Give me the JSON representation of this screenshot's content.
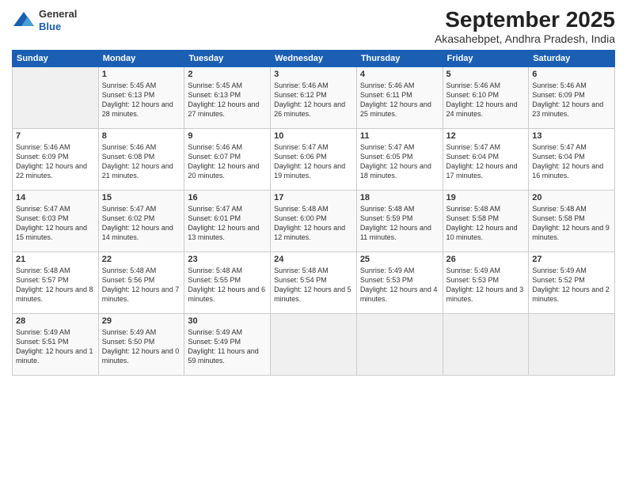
{
  "logo": {
    "general": "General",
    "blue": "Blue"
  },
  "title": "September 2025",
  "subtitle": "Akasahebpet, Andhra Pradesh, India",
  "headers": [
    "Sunday",
    "Monday",
    "Tuesday",
    "Wednesday",
    "Thursday",
    "Friday",
    "Saturday"
  ],
  "weeks": [
    [
      {
        "day": "",
        "sunrise": "",
        "sunset": "",
        "daylight": ""
      },
      {
        "day": "1",
        "sunrise": "Sunrise: 5:45 AM",
        "sunset": "Sunset: 6:13 PM",
        "daylight": "Daylight: 12 hours and 28 minutes."
      },
      {
        "day": "2",
        "sunrise": "Sunrise: 5:45 AM",
        "sunset": "Sunset: 6:13 PM",
        "daylight": "Daylight: 12 hours and 27 minutes."
      },
      {
        "day": "3",
        "sunrise": "Sunrise: 5:46 AM",
        "sunset": "Sunset: 6:12 PM",
        "daylight": "Daylight: 12 hours and 26 minutes."
      },
      {
        "day": "4",
        "sunrise": "Sunrise: 5:46 AM",
        "sunset": "Sunset: 6:11 PM",
        "daylight": "Daylight: 12 hours and 25 minutes."
      },
      {
        "day": "5",
        "sunrise": "Sunrise: 5:46 AM",
        "sunset": "Sunset: 6:10 PM",
        "daylight": "Daylight: 12 hours and 24 minutes."
      },
      {
        "day": "6",
        "sunrise": "Sunrise: 5:46 AM",
        "sunset": "Sunset: 6:09 PM",
        "daylight": "Daylight: 12 hours and 23 minutes."
      }
    ],
    [
      {
        "day": "7",
        "sunrise": "Sunrise: 5:46 AM",
        "sunset": "Sunset: 6:09 PM",
        "daylight": "Daylight: 12 hours and 22 minutes."
      },
      {
        "day": "8",
        "sunrise": "Sunrise: 5:46 AM",
        "sunset": "Sunset: 6:08 PM",
        "daylight": "Daylight: 12 hours and 21 minutes."
      },
      {
        "day": "9",
        "sunrise": "Sunrise: 5:46 AM",
        "sunset": "Sunset: 6:07 PM",
        "daylight": "Daylight: 12 hours and 20 minutes."
      },
      {
        "day": "10",
        "sunrise": "Sunrise: 5:47 AM",
        "sunset": "Sunset: 6:06 PM",
        "daylight": "Daylight: 12 hours and 19 minutes."
      },
      {
        "day": "11",
        "sunrise": "Sunrise: 5:47 AM",
        "sunset": "Sunset: 6:05 PM",
        "daylight": "Daylight: 12 hours and 18 minutes."
      },
      {
        "day": "12",
        "sunrise": "Sunrise: 5:47 AM",
        "sunset": "Sunset: 6:04 PM",
        "daylight": "Daylight: 12 hours and 17 minutes."
      },
      {
        "day": "13",
        "sunrise": "Sunrise: 5:47 AM",
        "sunset": "Sunset: 6:04 PM",
        "daylight": "Daylight: 12 hours and 16 minutes."
      }
    ],
    [
      {
        "day": "14",
        "sunrise": "Sunrise: 5:47 AM",
        "sunset": "Sunset: 6:03 PM",
        "daylight": "Daylight: 12 hours and 15 minutes."
      },
      {
        "day": "15",
        "sunrise": "Sunrise: 5:47 AM",
        "sunset": "Sunset: 6:02 PM",
        "daylight": "Daylight: 12 hours and 14 minutes."
      },
      {
        "day": "16",
        "sunrise": "Sunrise: 5:47 AM",
        "sunset": "Sunset: 6:01 PM",
        "daylight": "Daylight: 12 hours and 13 minutes."
      },
      {
        "day": "17",
        "sunrise": "Sunrise: 5:48 AM",
        "sunset": "Sunset: 6:00 PM",
        "daylight": "Daylight: 12 hours and 12 minutes."
      },
      {
        "day": "18",
        "sunrise": "Sunrise: 5:48 AM",
        "sunset": "Sunset: 5:59 PM",
        "daylight": "Daylight: 12 hours and 11 minutes."
      },
      {
        "day": "19",
        "sunrise": "Sunrise: 5:48 AM",
        "sunset": "Sunset: 5:58 PM",
        "daylight": "Daylight: 12 hours and 10 minutes."
      },
      {
        "day": "20",
        "sunrise": "Sunrise: 5:48 AM",
        "sunset": "Sunset: 5:58 PM",
        "daylight": "Daylight: 12 hours and 9 minutes."
      }
    ],
    [
      {
        "day": "21",
        "sunrise": "Sunrise: 5:48 AM",
        "sunset": "Sunset: 5:57 PM",
        "daylight": "Daylight: 12 hours and 8 minutes."
      },
      {
        "day": "22",
        "sunrise": "Sunrise: 5:48 AM",
        "sunset": "Sunset: 5:56 PM",
        "daylight": "Daylight: 12 hours and 7 minutes."
      },
      {
        "day": "23",
        "sunrise": "Sunrise: 5:48 AM",
        "sunset": "Sunset: 5:55 PM",
        "daylight": "Daylight: 12 hours and 6 minutes."
      },
      {
        "day": "24",
        "sunrise": "Sunrise: 5:48 AM",
        "sunset": "Sunset: 5:54 PM",
        "daylight": "Daylight: 12 hours and 5 minutes."
      },
      {
        "day": "25",
        "sunrise": "Sunrise: 5:49 AM",
        "sunset": "Sunset: 5:53 PM",
        "daylight": "Daylight: 12 hours and 4 minutes."
      },
      {
        "day": "26",
        "sunrise": "Sunrise: 5:49 AM",
        "sunset": "Sunset: 5:53 PM",
        "daylight": "Daylight: 12 hours and 3 minutes."
      },
      {
        "day": "27",
        "sunrise": "Sunrise: 5:49 AM",
        "sunset": "Sunset: 5:52 PM",
        "daylight": "Daylight: 12 hours and 2 minutes."
      }
    ],
    [
      {
        "day": "28",
        "sunrise": "Sunrise: 5:49 AM",
        "sunset": "Sunset: 5:51 PM",
        "daylight": "Daylight: 12 hours and 1 minute."
      },
      {
        "day": "29",
        "sunrise": "Sunrise: 5:49 AM",
        "sunset": "Sunset: 5:50 PM",
        "daylight": "Daylight: 12 hours and 0 minutes."
      },
      {
        "day": "30",
        "sunrise": "Sunrise: 5:49 AM",
        "sunset": "Sunset: 5:49 PM",
        "daylight": "Daylight: 11 hours and 59 minutes."
      },
      {
        "day": "",
        "sunrise": "",
        "sunset": "",
        "daylight": ""
      },
      {
        "day": "",
        "sunrise": "",
        "sunset": "",
        "daylight": ""
      },
      {
        "day": "",
        "sunrise": "",
        "sunset": "",
        "daylight": ""
      },
      {
        "day": "",
        "sunrise": "",
        "sunset": "",
        "daylight": ""
      }
    ]
  ]
}
